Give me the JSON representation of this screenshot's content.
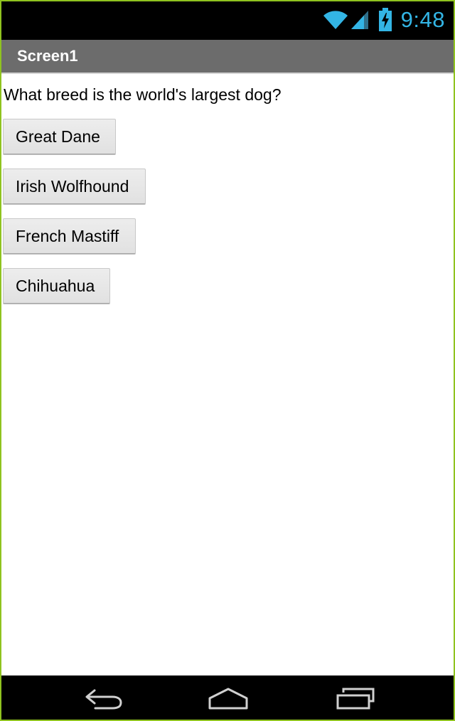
{
  "status_bar": {
    "time": "9:48",
    "icons": [
      "wifi-icon",
      "signal-icon",
      "battery-charging-icon"
    ],
    "accent_color": "#33b5e5"
  },
  "title_bar": {
    "title": "Screen1",
    "background_color": "#6c6c6c"
  },
  "main": {
    "question": "What breed is the world's largest dog?",
    "answers": [
      {
        "label": "Great Dane"
      },
      {
        "label": "Irish Wolfhound"
      },
      {
        "label": "French Mastiff"
      },
      {
        "label": "Chihuahua"
      }
    ]
  },
  "nav_bar": {
    "buttons": [
      "back-icon",
      "home-icon",
      "recent-apps-icon"
    ]
  }
}
